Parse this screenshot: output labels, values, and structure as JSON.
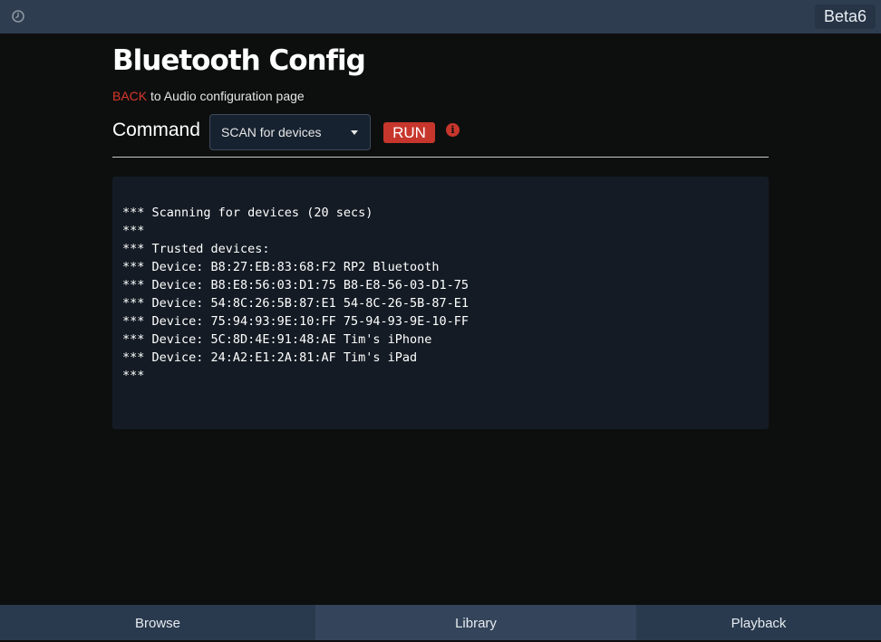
{
  "header": {
    "version": "Beta6"
  },
  "page": {
    "title": "Bluetooth Config",
    "back_link": "BACK",
    "back_text": " to Audio configuration page"
  },
  "command": {
    "label": "Command",
    "selected": "SCAN for devices",
    "run_label": "RUN",
    "info_glyph": "i"
  },
  "output": {
    "lines": [
      "*** Scanning for devices (20 secs)",
      "***",
      "*** Trusted devices:",
      "*** Device: B8:27:EB:83:68:F2 RP2 Bluetooth",
      "*** Device: B8:E8:56:03:D1:75 B8-E8-56-03-D1-75",
      "*** Device: 54:8C:26:5B:87:E1 54-8C-26-5B-87-E1",
      "*** Device: 75:94:93:9E:10:FF 75-94-93-9E-10-FF",
      "*** Device: 5C:8D:4E:91:48:AE Tim's iPhone",
      "*** Device: 24:A2:E1:2A:81:AF Tim's iPad",
      "***"
    ]
  },
  "nav": {
    "tabs": [
      {
        "label": "Browse"
      },
      {
        "label": "Library"
      },
      {
        "label": "Playback"
      }
    ],
    "active": "Library"
  },
  "icons": {
    "clock": "clock-icon",
    "caret": "caret-down-icon",
    "info": "info-icon"
  },
  "colors": {
    "accent": "#c7362c",
    "topbar": "#2e3d50",
    "panel": "#141b24"
  }
}
